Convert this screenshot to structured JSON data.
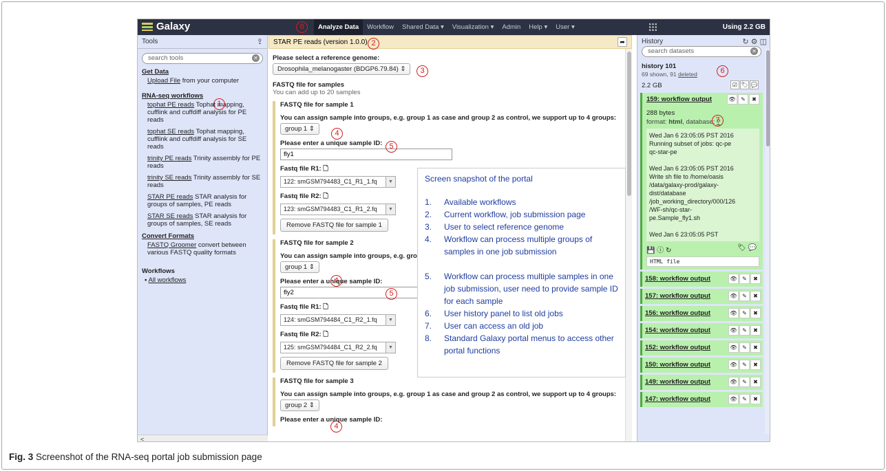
{
  "masthead": {
    "brand": "Galaxy",
    "nav": [
      "Analyze Data",
      "Workflow",
      "Shared Data ▾",
      "Visualization ▾",
      "Admin",
      "Help ▾",
      "User ▾"
    ],
    "usage": "Using 2.2 GB"
  },
  "tools_panel": {
    "title": "Tools",
    "search_placeholder": "search tools",
    "sections": [
      {
        "name": "Get Data",
        "tools": [
          {
            "name": "Upload File",
            "desc": " from your computer"
          }
        ]
      },
      {
        "name": "RNA-seq workflows",
        "tools": [
          {
            "name": "tophat PE reads",
            "desc": " Tophat mapping, cufflink and cuffdiff analysis for PE reads"
          },
          {
            "name": "tophat SE reads",
            "desc": " Tophat mapping, cufflink and cuffdiff analysis for SE reads"
          },
          {
            "name": "trinity PE reads",
            "desc": " Trinity assembly for PE reads"
          },
          {
            "name": "trinity SE reads",
            "desc": " Trinity assembly for SE reads"
          },
          {
            "name": "STAR PE reads",
            "desc": " STAR analysis for groups of samples, PE reads"
          },
          {
            "name": "STAR SE reads",
            "desc": " STAR analysis for groups of samples, SE reads"
          }
        ]
      },
      {
        "name": "Convert Formats",
        "tools": [
          {
            "name": "FASTQ Groomer",
            "desc": " convert between various FASTQ quality formats"
          }
        ]
      }
    ],
    "workflows_title": "Workflows",
    "workflows_link": "All workflows"
  },
  "center": {
    "title": "STAR PE reads (version 1.0.0)",
    "genome_label": "Please select a reference genome:",
    "genome_value": "Drosophila_melanogaster (BDGP6.79.84)",
    "fastq_label": "FASTQ file for samples",
    "fastq_sub": "You can add up to 20 samples",
    "group_label": "You can assign sample into groups, e.g. group 1 as case and group 2 as control, we support up to 4 groups:",
    "id_label": "Please enter a unique sample ID:",
    "r1_label": "Fastq file R1:",
    "r2_label": "Fastq file R2:",
    "samples": [
      {
        "title": "FASTQ file for sample 1",
        "group": "group 1",
        "id": "fly1",
        "r1": "122: smGSM794483_C1_R1_1.fq",
        "r2": "123: smGSM794483_C1_R1_2.fq",
        "remove": "Remove FASTQ file for sample 1"
      },
      {
        "title": "FASTQ file for sample 2",
        "group": "group 1",
        "id": "fly2",
        "r1": "124: smGSM794484_C1_R2_1.fq",
        "r2": "125: smGSM794484_C1_R2_2.fq",
        "remove": "Remove FASTQ file for sample 2"
      },
      {
        "title": "FASTQ file for sample 3",
        "group": "group 2",
        "id_label_partial": "Please enter a unique sample ID:"
      }
    ]
  },
  "history": {
    "title": "History",
    "search_placeholder": "search datasets",
    "name": "history 101",
    "shown": "69 shown, 91 ",
    "deleted": "deleted",
    "size": "2.2 GB",
    "expanded": {
      "title": "159: workflow output",
      "bytes": "288 bytes",
      "format_prefix": "format: ",
      "format": "html",
      "db_prefix": ", database: ",
      "db": "?",
      "peek": [
        "Wed Jan 6 23:05:05 PST 2016",
        "Running subset of jobs: qc-pe",
        "qc-star-pe",
        "",
        "Wed Jan 6 23:05:05 PST 2016",
        "Write sh file to /home/oasis",
        "/data/galaxy-prod/galaxy-",
        "dist/database",
        "/job_working_directory/000/126",
        "/WF-sh/qc-star-",
        "pe.Sample_fly1.sh",
        "",
        "Wed Jan 6 23:05:05 PST"
      ],
      "file_type": "HTML file"
    },
    "items": [
      "158: workflow output",
      "157: workflow output",
      "156: workflow output",
      "154: workflow output",
      "152: workflow output",
      "150: workflow output",
      "149: workflow output",
      "147: workflow output"
    ]
  },
  "overlay": {
    "title": "Screen snapshot of the portal",
    "items": [
      {
        "n": "1.",
        "text": "Available workflows"
      },
      {
        "n": "2.",
        "text": "Current workflow, job submission page"
      },
      {
        "n": "3.",
        "text": "User to select reference genome"
      },
      {
        "n": "4.",
        "text": "Workflow can process multiple groups of samples in one job submission"
      },
      {
        "n": "5.",
        "text": "Workflow can process multiple samples in one job submission, user need to provide sample ID for each sample"
      },
      {
        "n": "6.",
        "text": "User history panel to list old jobs"
      },
      {
        "n": "7.",
        "text": "User can access an old job"
      },
      {
        "n": "8.",
        "text": "Standard Galaxy portal menus to access other portal functions"
      }
    ]
  },
  "markers": [
    "1",
    "2",
    "3",
    "4",
    "5",
    "6",
    "7",
    "8"
  ],
  "caption": {
    "prefix": "Fig. 3",
    "text": " Screenshot of the RNA-seq portal job submission page"
  },
  "colors": {
    "masthead": "#2c3143",
    "tool_panel": "#dfe5f9",
    "ok_dataset": "#b9f0ad",
    "marker": "#d02020",
    "overlay_text": "#1e3ca0"
  }
}
